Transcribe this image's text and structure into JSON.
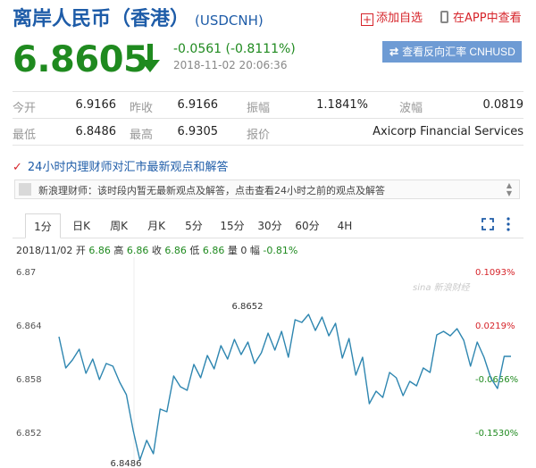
{
  "header": {
    "title": "离岸人民币（香港）",
    "code": "(USDCNH)",
    "add_watchlist": "添加自选",
    "view_in_app": "在APP中查看"
  },
  "quote": {
    "price": "6.8605",
    "change": "-0.0561 (-0.8111%)",
    "time": "2018-11-02 20:06:36",
    "direction": "down",
    "reverse_button": "查看反向汇率 CNHUSD"
  },
  "stats": [
    [
      {
        "label": "今开",
        "value": "6.9166"
      },
      {
        "label": "昨收",
        "value": "6.9166"
      },
      {
        "label": "振幅",
        "value": "1.1841%"
      },
      {
        "label": "波幅",
        "value": "0.0819"
      }
    ],
    [
      {
        "label": "最低",
        "value": "6.8486"
      },
      {
        "label": "最高",
        "value": "6.9305"
      },
      {
        "label": "报价",
        "value": "Axicorp Financial Services"
      }
    ]
  ],
  "opinion": {
    "title": "24小时内理财师对汇市最新观点和解答",
    "message": "新浪理财师：该时段内暂无最新观点及解答，点击查看24小时之前的观点及解答"
  },
  "tabs": [
    "1分",
    "日K",
    "周K",
    "月K",
    "5分",
    "15分",
    "30分",
    "60分",
    "4H"
  ],
  "active_tab": 0,
  "ohlc": {
    "date": "2018/11/02",
    "open_label": "开",
    "open": "6.86",
    "high_label": "高",
    "high": "6.86",
    "close_label": "收",
    "close": "6.86",
    "low_label": "低",
    "low": "6.86",
    "vol_label": "量",
    "vol": "0",
    "amp_label": "幅",
    "amp": "-0.81%"
  },
  "chart_data": {
    "type": "line",
    "y_ticks": [
      6.87,
      6.864,
      6.858,
      6.852
    ],
    "ylim": [
      6.848,
      6.87
    ],
    "pct_ticks": [
      {
        "label": "0.1093%",
        "value": 6.87
      },
      {
        "label": "0.0219%",
        "value": 6.864
      },
      {
        "label": "-0.0656%",
        "value": 6.858
      },
      {
        "label": "-0.1530%",
        "value": 6.852
      }
    ],
    "annotations": [
      {
        "text": "6.8652",
        "index": 28
      },
      {
        "text": "6.8486",
        "index": 10
      }
    ],
    "watermark": "sina 新浪财经",
    "colors": {
      "line": "#2e86b0",
      "up": "#d6242a",
      "down": "#1f8a1f"
    },
    "values": [
      6.8627,
      6.8592,
      6.8601,
      6.8613,
      6.8586,
      6.8602,
      6.8579,
      6.8597,
      6.8594,
      6.8576,
      6.8562,
      6.8522,
      6.8489,
      6.8511,
      6.8496,
      6.8546,
      6.8543,
      6.8583,
      6.8571,
      6.8567,
      6.8596,
      6.8581,
      6.8606,
      6.8591,
      6.8617,
      6.8602,
      6.8624,
      6.8607,
      6.8621,
      6.8597,
      6.8609,
      6.8631,
      6.8612,
      6.8633,
      6.8604,
      6.8646,
      6.8643,
      6.8652,
      6.8634,
      6.8649,
      6.8628,
      6.8642,
      6.8603,
      6.8625,
      6.8584,
      6.8604,
      6.8552,
      6.8566,
      6.8559,
      6.8587,
      6.8581,
      6.8561,
      6.8577,
      6.8572,
      6.8592,
      6.8587,
      6.8629,
      6.8633,
      6.8628,
      6.8636,
      6.8623,
      6.8594,
      6.8621,
      6.8604,
      6.8581,
      6.8569,
      6.8605,
      6.8605
    ]
  }
}
